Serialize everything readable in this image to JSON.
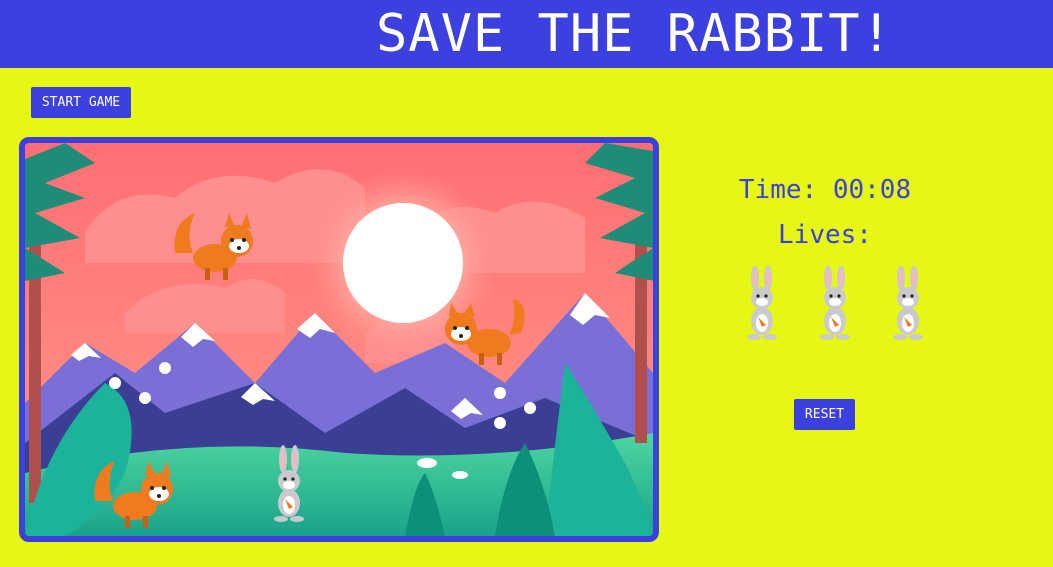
{
  "app": {
    "title": "SAVE THE RABBIT!"
  },
  "controls": {
    "start_label": "START GAME",
    "reset_label": "RESET"
  },
  "stats": {
    "time_label": "Time:",
    "time_value": "00:08",
    "lives_label": "Lives:",
    "lives_remaining": 3
  },
  "scene": {
    "foxes": 3,
    "rabbits": 1
  },
  "colors": {
    "accent": "#3b40de",
    "page_background": "#e6f714",
    "sky": "#ff7475"
  }
}
